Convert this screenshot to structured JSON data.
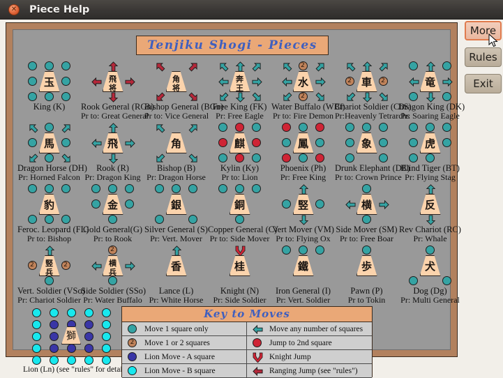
{
  "window": {
    "title": "Piece Help",
    "close_icon": "close-icon"
  },
  "side_buttons": [
    {
      "label": "More",
      "state": "hovered"
    },
    {
      "label": "Rules",
      "state": "normal"
    },
    {
      "label": "Exit",
      "state": "normal"
    }
  ],
  "banner": {
    "title": "Tenjiku Shogi - Pieces"
  },
  "colors": {
    "frame": "#b2815e",
    "board_bg": "#999999",
    "banner_bg": "#eaa877",
    "banner_text": "#3f5fbf",
    "tile": "#fbd3ac",
    "teal": "#35a3a3",
    "red": "#cf2435",
    "blue": "#3a36a6",
    "cyan": "#18e8ee",
    "two_circle": "#c0835b"
  },
  "pieces": [
    {
      "kanji": "玉",
      "name": "King (K)",
      "promo": "",
      "markers": [
        [
          "nw",
          "dot-teal"
        ],
        [
          "n",
          "dot-teal"
        ],
        [
          "ne",
          "dot-teal"
        ],
        [
          "w",
          "dot-teal"
        ],
        [
          "e",
          "dot-teal"
        ],
        [
          "sw",
          "dot-teal"
        ],
        [
          "s",
          "dot-teal"
        ],
        [
          "se",
          "dot-teal"
        ]
      ]
    },
    {
      "kanji": "飛将",
      "name": "Rook General (RGn)",
      "promo": "Pr to: Great General",
      "markers": [
        [
          "n",
          "jump-red"
        ],
        [
          "w",
          "jump-red"
        ],
        [
          "e",
          "jump-red"
        ],
        [
          "s",
          "jump-red"
        ]
      ]
    },
    {
      "kanji": "角将",
      "name": "Bishop General (BGn)",
      "promo": "Pr to: Vice General",
      "markers": [
        [
          "nw",
          "jump-red"
        ],
        [
          "ne",
          "jump-red"
        ],
        [
          "sw",
          "jump-red"
        ],
        [
          "se",
          "jump-red"
        ]
      ]
    },
    {
      "kanji": "奔王",
      "name": "Free King (FK)",
      "promo": "Pr: Free Eagle",
      "markers": [
        [
          "nw",
          "arrow-teal"
        ],
        [
          "n",
          "arrow-teal"
        ],
        [
          "ne",
          "arrow-teal"
        ],
        [
          "w",
          "arrow-teal"
        ],
        [
          "e",
          "arrow-teal"
        ],
        [
          "sw",
          "arrow-teal"
        ],
        [
          "s",
          "arrow-teal"
        ],
        [
          "se",
          "arrow-teal"
        ]
      ]
    },
    {
      "kanji": "水",
      "name": "Water Buffalo (WBt)",
      "promo": "Pr to: Fire Demon",
      "markers": [
        [
          "nw",
          "arrow-teal"
        ],
        [
          "n",
          "two"
        ],
        [
          "ne",
          "arrow-teal"
        ],
        [
          "w",
          "arrow-teal"
        ],
        [
          "e",
          "arrow-teal"
        ],
        [
          "sw",
          "arrow-teal"
        ],
        [
          "s",
          "two"
        ],
        [
          "se",
          "arrow-teal"
        ]
      ]
    },
    {
      "kanji": "車",
      "name": "Chariot Soldier (ChS)",
      "promo": "Pr:Heavenly Tetrarchs",
      "markers": [
        [
          "nw",
          "arrow-teal"
        ],
        [
          "n",
          "arrow-teal"
        ],
        [
          "ne",
          "arrow-teal"
        ],
        [
          "w",
          "two"
        ],
        [
          "e",
          "two"
        ],
        [
          "sw",
          "arrow-teal"
        ],
        [
          "s",
          "arrow-teal"
        ],
        [
          "se",
          "arrow-teal"
        ]
      ]
    },
    {
      "kanji": "竜",
      "name": "Dragon King (DK)",
      "promo": "Pr: Soaring Eagle",
      "markers": [
        [
          "nw",
          "dot-teal"
        ],
        [
          "n",
          "arrow-teal"
        ],
        [
          "ne",
          "dot-teal"
        ],
        [
          "w",
          "arrow-teal"
        ],
        [
          "e",
          "arrow-teal"
        ],
        [
          "sw",
          "dot-teal"
        ],
        [
          "s",
          "arrow-teal"
        ],
        [
          "se",
          "dot-teal"
        ]
      ]
    },
    {
      "kanji": "馬",
      "name": "Dragon Horse (DH)",
      "promo": "Pr: Horned Falcon",
      "markers": [
        [
          "nw",
          "arrow-teal"
        ],
        [
          "n",
          "dot-teal"
        ],
        [
          "ne",
          "arrow-teal"
        ],
        [
          "w",
          "dot-teal"
        ],
        [
          "e",
          "dot-teal"
        ],
        [
          "sw",
          "arrow-teal"
        ],
        [
          "s",
          "dot-teal"
        ],
        [
          "se",
          "arrow-teal"
        ]
      ]
    },
    {
      "kanji": "飛",
      "name": "Rook (R)",
      "promo": "Pr: Dragon King",
      "markers": [
        [
          "n",
          "arrow-teal"
        ],
        [
          "w",
          "arrow-teal"
        ],
        [
          "e",
          "arrow-teal"
        ],
        [
          "s",
          "arrow-teal"
        ]
      ]
    },
    {
      "kanji": "角",
      "name": "Bishop (B)",
      "promo": "Pr: Dragon Horse",
      "markers": [
        [
          "nw",
          "arrow-teal"
        ],
        [
          "ne",
          "arrow-teal"
        ],
        [
          "sw",
          "arrow-teal"
        ],
        [
          "se",
          "arrow-teal"
        ]
      ]
    },
    {
      "kanji": "麒",
      "name": "Kylin (Ky)",
      "promo": "Pr to:  Lion",
      "markers": [
        [
          "nw",
          "dot-teal"
        ],
        [
          "n",
          "dot-red"
        ],
        [
          "ne",
          "dot-teal"
        ],
        [
          "w",
          "dot-red"
        ],
        [
          "e",
          "dot-red"
        ],
        [
          "sw",
          "dot-teal"
        ],
        [
          "s",
          "dot-red"
        ],
        [
          "se",
          "dot-teal"
        ]
      ]
    },
    {
      "kanji": "鳳",
      "name": "Phoenix (Ph)",
      "promo": "Pr: Free King",
      "markers": [
        [
          "nw",
          "dot-red"
        ],
        [
          "n",
          "dot-teal"
        ],
        [
          "ne",
          "dot-red"
        ],
        [
          "w",
          "dot-teal"
        ],
        [
          "e",
          "dot-teal"
        ],
        [
          "sw",
          "dot-red"
        ],
        [
          "s",
          "dot-teal"
        ],
        [
          "se",
          "dot-red"
        ]
      ]
    },
    {
      "kanji": "象",
      "name": "Drunk Elephant (DE)",
      "promo": "Pr to: Crown Prince",
      "markers": [
        [
          "nw",
          "dot-teal"
        ],
        [
          "n",
          "dot-teal"
        ],
        [
          "ne",
          "dot-teal"
        ],
        [
          "w",
          "dot-teal"
        ],
        [
          "e",
          "dot-teal"
        ],
        [
          "sw",
          "dot-teal"
        ],
        [
          "se",
          "dot-teal"
        ]
      ]
    },
    {
      "kanji": "虎",
      "name": "Blind Tiger (BT)",
      "promo": "Pr: Flying Stag",
      "markers": [
        [
          "nw",
          "dot-teal"
        ],
        [
          "ne",
          "dot-teal"
        ],
        [
          "w",
          "dot-teal"
        ],
        [
          "e",
          "dot-teal"
        ],
        [
          "sw",
          "dot-teal"
        ],
        [
          "s",
          "dot-teal"
        ],
        [
          "n",
          "dot-teal"
        ]
      ]
    },
    {
      "kanji": "豹",
      "name": "Feroc. Leopard (FL)",
      "promo": "Pr to:  Bishop",
      "markers": [
        [
          "nw",
          "dot-teal"
        ],
        [
          "n",
          "dot-teal"
        ],
        [
          "ne",
          "dot-teal"
        ],
        [
          "sw",
          "dot-teal"
        ],
        [
          "s",
          "dot-teal"
        ],
        [
          "se",
          "dot-teal"
        ]
      ]
    },
    {
      "kanji": "金",
      "name": "Gold General(G)",
      "promo": "Pr: to Rook",
      "markers": [
        [
          "nw",
          "dot-teal"
        ],
        [
          "n",
          "dot-teal"
        ],
        [
          "ne",
          "dot-teal"
        ],
        [
          "w",
          "dot-teal"
        ],
        [
          "e",
          "dot-teal"
        ],
        [
          "s",
          "dot-teal"
        ]
      ]
    },
    {
      "kanji": "銀",
      "name": "Silver General (S)",
      "promo": "Pr: Vert. Mover",
      "markers": [
        [
          "nw",
          "dot-teal"
        ],
        [
          "n",
          "dot-teal"
        ],
        [
          "ne",
          "dot-teal"
        ],
        [
          "sw",
          "dot-teal"
        ],
        [
          "se",
          "dot-teal"
        ]
      ]
    },
    {
      "kanji": "銅",
      "name": "Copper General (C)",
      "promo": "Pr to: Side Mover",
      "markers": [
        [
          "nw",
          "dot-teal"
        ],
        [
          "n",
          "dot-teal"
        ],
        [
          "ne",
          "dot-teal"
        ],
        [
          "s",
          "dot-teal"
        ]
      ]
    },
    {
      "kanji": "竪",
      "name": "Vert Mover (VM)",
      "promo": "Pr to: Flying Ox",
      "markers": [
        [
          "n",
          "arrow-teal"
        ],
        [
          "w",
          "dot-teal"
        ],
        [
          "e",
          "dot-teal"
        ],
        [
          "s",
          "arrow-teal"
        ]
      ]
    },
    {
      "kanji": "横",
      "name": "Side Mover (SM)",
      "promo": "Pr to: Free Boar",
      "markers": [
        [
          "n",
          "dot-teal"
        ],
        [
          "w",
          "arrow-teal"
        ],
        [
          "e",
          "arrow-teal"
        ],
        [
          "s",
          "dot-teal"
        ]
      ]
    },
    {
      "kanji": "反",
      "name": "Rev  Chariot (RC)",
      "promo": "Pr: Whale",
      "markers": [
        [
          "n",
          "arrow-teal"
        ],
        [
          "s",
          "arrow-teal"
        ]
      ]
    },
    {
      "kanji": "竪兵",
      "name": "Vert. Soldier (VSo)",
      "promo": "Pr: Chariot Soldier",
      "markers": [
        [
          "n",
          "arrow-teal"
        ],
        [
          "w",
          "two"
        ],
        [
          "e",
          "two"
        ],
        [
          "s",
          "dot-teal"
        ]
      ]
    },
    {
      "kanji": "横兵",
      "name": "Side Soldier (SSo)",
      "promo": "Pr: Water Buffalo",
      "markers": [
        [
          "n",
          "two"
        ],
        [
          "w",
          "arrow-teal"
        ],
        [
          "e",
          "arrow-teal"
        ],
        [
          "s",
          "dot-teal"
        ]
      ]
    },
    {
      "kanji": "香",
      "name": "Lance (L)",
      "promo": "Pr: White Horse",
      "markers": [
        [
          "n",
          "arrow-teal"
        ]
      ]
    },
    {
      "kanji": "桂",
      "name": "Knight (N)",
      "promo": "Pr: Side Soldier",
      "markers": [
        [
          "n",
          "knight-red"
        ]
      ]
    },
    {
      "kanji": "鐵",
      "name": "Iron General (I)",
      "promo": "Pr: Vert. Soldier",
      "markers": [
        [
          "nw",
          "dot-teal"
        ],
        [
          "n",
          "dot-teal"
        ],
        [
          "ne",
          "dot-teal"
        ]
      ]
    },
    {
      "kanji": "歩",
      "name": "Pawn (P)",
      "promo": "Pr to Tokin",
      "markers": [
        [
          "n",
          "dot-teal"
        ]
      ]
    },
    {
      "kanji": "犬",
      "name": "Dog (Dg)",
      "promo": "Pr: Multi General",
      "markers": [
        [
          "n",
          "dot-teal"
        ],
        [
          "sw",
          "dot-teal"
        ],
        [
          "se",
          "dot-teal"
        ]
      ]
    }
  ],
  "lion": {
    "kanji": "獅",
    "caption": "Lion (Ln)  (see \"rules\" for details)"
  },
  "key": {
    "title": "Key to Moves",
    "rows": [
      {
        "sym": "dot-teal",
        "label": "Move 1 square only"
      },
      {
        "sym": "arrow-teal",
        "label": "Move any number of squares"
      },
      {
        "sym": "two",
        "label": "Move 1 or 2 squares"
      },
      {
        "sym": "dot-red",
        "label": "Jump to 2nd square"
      },
      {
        "sym": "dot-blue",
        "label": "Lion Move  -  A square"
      },
      {
        "sym": "knight-red",
        "label": "Knight Jump"
      },
      {
        "sym": "dot-cyan",
        "label": "Lion Move  -  B square"
      },
      {
        "sym": "jump-red",
        "label": "Ranging Jump  (see \"rules\")"
      }
    ]
  }
}
